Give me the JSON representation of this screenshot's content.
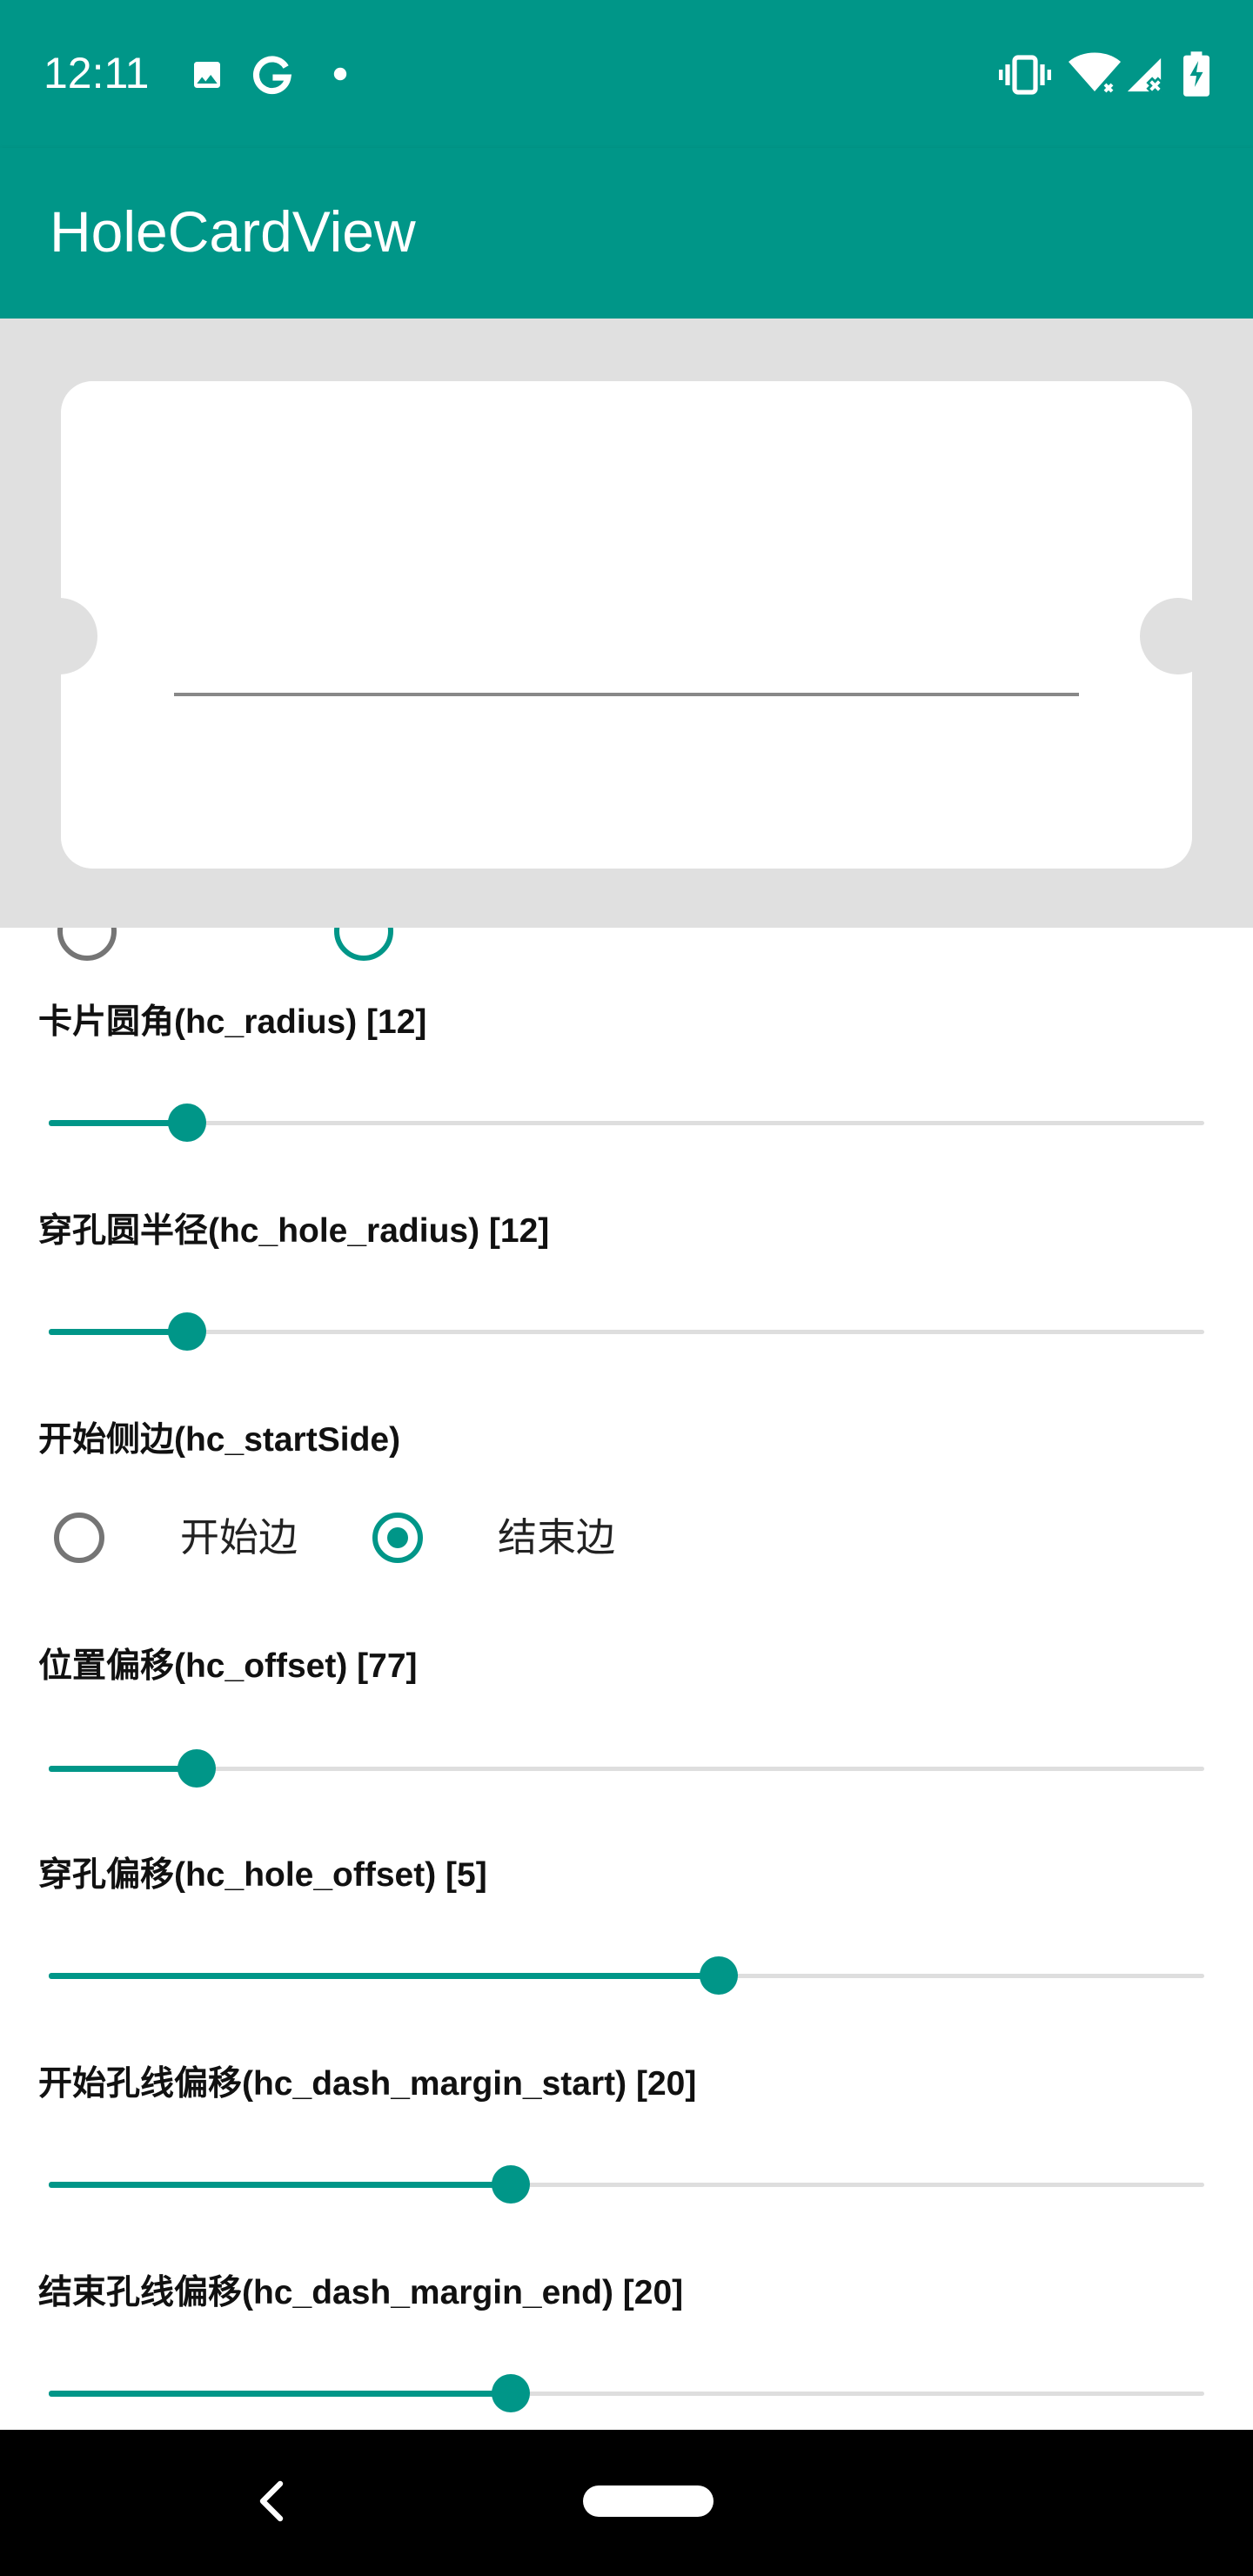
{
  "status_bar": {
    "time": "12:11",
    "left_icons": [
      "image-icon",
      "google-icon",
      "dot-icon"
    ],
    "right_icons": [
      "vibrate-icon",
      "wifi-icon",
      "signal-icon",
      "battery-icon"
    ]
  },
  "app_bar": {
    "title": "HoleCardView"
  },
  "colors": {
    "primary": "#009688",
    "preview_background": "#e0e0e0",
    "card": "#ffffff",
    "dash_line": "#888888",
    "track": "#dedede",
    "radio_off": "#757575"
  },
  "settings": [
    {
      "label": "卡片圆角(hc_radius) [12]",
      "level_fraction": 0.12
    },
    {
      "label": "穿孔圆半径(hc_hole_radius) [12]",
      "level_fraction": 0.12
    },
    {
      "label": "开始侧边(hc_startSide)",
      "options": [
        "开始边",
        "结束边"
      ],
      "selected": "结束边"
    },
    {
      "label": "位置偏移(hc_offset) [77]",
      "level_fraction": 0.128
    },
    {
      "label": "穿孔偏移(hc_hole_offset) [5]",
      "level_fraction": 0.58
    },
    {
      "label": "开始孔线偏移(hc_dash_margin_start) [20]",
      "level_fraction": 0.4
    },
    {
      "label": "结束孔线偏移(hc_dash_margin_end) [20]",
      "level_fraction": 0.4
    }
  ],
  "nav_bar": {
    "back_icon": "back-icon",
    "home_icon": "home-pill-icon"
  }
}
